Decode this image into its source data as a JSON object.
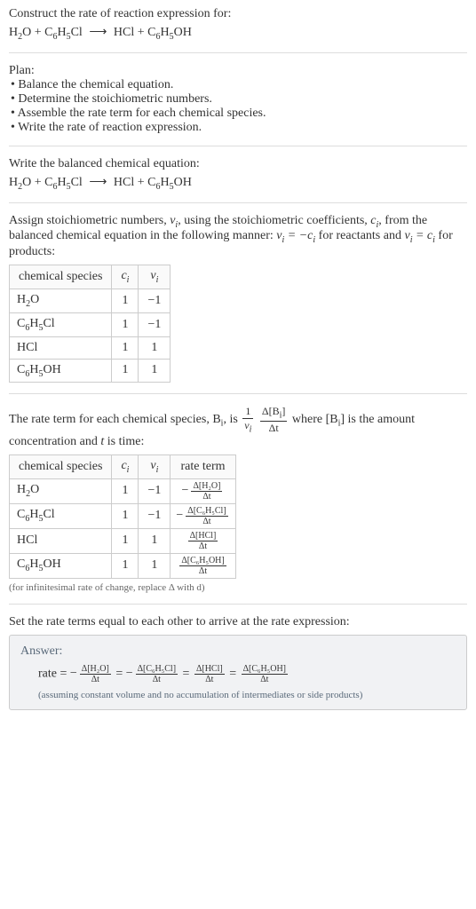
{
  "s1": {
    "title": "Construct the rate of reaction expression for:",
    "eq_lhs_a": "H",
    "eq_lhs_a_sub": "2",
    "eq_lhs_a_tail": "O + C",
    "eq_lhs_b_sub": "6",
    "eq_lhs_b_mid": "H",
    "eq_lhs_c_sub": "5",
    "eq_lhs_c_tail": "Cl",
    "arrow": "⟶",
    "eq_rhs_a": "HCl + C",
    "eq_rhs_b_sub": "6",
    "eq_rhs_b_mid": "H",
    "eq_rhs_c_sub": "5",
    "eq_rhs_c_tail": "OH"
  },
  "s2": {
    "title": "Plan:",
    "b1": "• Balance the chemical equation.",
    "b2": "• Determine the stoichiometric numbers.",
    "b3": "• Assemble the rate term for each chemical species.",
    "b4": "• Write the rate of reaction expression."
  },
  "s3": {
    "title": "Write the balanced chemical equation:"
  },
  "s4": {
    "line1a": "Assign stoichiometric numbers, ",
    "line1b": ", using the stoichiometric coefficients, ",
    "line1c": ", from the balanced chemical equation in the following manner: ",
    "line1d": " for reactants and ",
    "line1e": " for products:",
    "nu_i": "ν",
    "nu_sub": "i",
    "c_i": "c",
    "c_sub": "i",
    "rel1a": "ν",
    "rel1b": " = −c",
    "rel2a": "ν",
    "rel2b": " = c",
    "th1": "chemical species",
    "th2": "c",
    "th2sub": "i",
    "th3": "ν",
    "th3sub": "i",
    "r1a": "H",
    "r1a_sub": "2",
    "r1a_tail": "O",
    "r1c": "1",
    "r1n": "−1",
    "r2a": "C",
    "r2a_sub": "6",
    "r2b": "H",
    "r2b_sub": "5",
    "r2c_tail": "Cl",
    "r2c": "1",
    "r2n": "−1",
    "r3a": "HCl",
    "r3c": "1",
    "r3n": "1",
    "r4a": "C",
    "r4a_sub": "6",
    "r4b": "H",
    "r4b_sub": "5",
    "r4c_tail": "OH",
    "r4c": "1",
    "r4n": "1"
  },
  "s5": {
    "line1a": "The rate term for each chemical species, B",
    "line1a_sub": "i",
    "line1b": ", is ",
    "frac1_num": "1",
    "frac1_den_a": "ν",
    "frac1_den_sub": "i",
    "frac2_num_a": "Δ[B",
    "frac2_num_sub": "i",
    "frac2_num_b": "]",
    "frac2_den": "Δt",
    "line1c": " where [B",
    "line1c_sub": "i",
    "line1d": "] is the amount concentration and ",
    "t": "t",
    "line1e": " is time:",
    "th1": "chemical species",
    "th2": "c",
    "th2sub": "i",
    "th3": "ν",
    "th3sub": "i",
    "th4": "rate term",
    "r1sp_a": "H",
    "r1sp_sub": "2",
    "r1sp_b": "O",
    "r1c": "1",
    "r1n": "−1",
    "r1rt_num": "Δ[H₂O]",
    "r1rt_den": "Δt",
    "r1neg": "−",
    "r2sp_a": "C",
    "r2sp_sub1": "6",
    "r2sp_b": "H",
    "r2sp_sub2": "5",
    "r2sp_c": "Cl",
    "r2c": "1",
    "r2n": "−1",
    "r2rt_num": "Δ[C₆H₅Cl]",
    "r2rt_den": "Δt",
    "r2neg": "−",
    "r3sp": "HCl",
    "r3c": "1",
    "r3n": "1",
    "r3rt_num": "Δ[HCl]",
    "r3rt_den": "Δt",
    "r4sp_a": "C",
    "r4sp_sub1": "6",
    "r4sp_b": "H",
    "r4sp_sub2": "5",
    "r4sp_c": "OH",
    "r4c": "1",
    "r4n": "1",
    "r4rt_num": "Δ[C₆H₅OH]",
    "r4rt_den": "Δt",
    "note": "(for infinitesimal rate of change, replace Δ with d)"
  },
  "s6": {
    "title": "Set the rate terms equal to each other to arrive at the rate expression:",
    "answer_label": "Answer:",
    "rate": "rate = ",
    "neg": "−",
    "eq": " = ",
    "t1_num": "Δ[H₂O]",
    "t1_den": "Δt",
    "t2_num": "Δ[C₆H₅Cl]",
    "t2_den": "Δt",
    "t3_num": "Δ[HCl]",
    "t3_den": "Δt",
    "t4_num": "Δ[C₆H₅OH]",
    "t4_den": "Δt",
    "note": "(assuming constant volume and no accumulation of intermediates or side products)"
  }
}
